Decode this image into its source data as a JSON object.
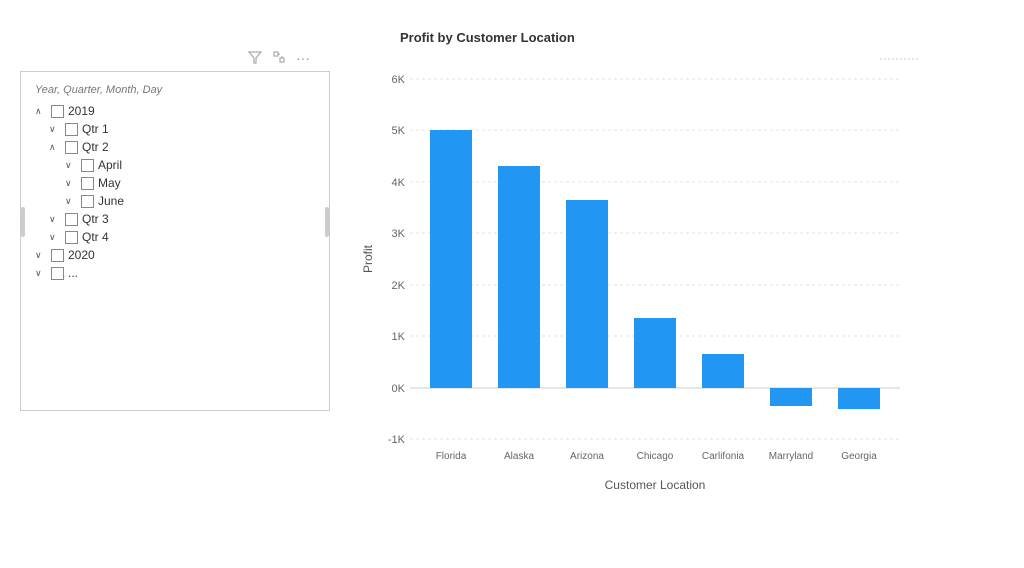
{
  "leftPanel": {
    "icons": [
      "filter-icon",
      "expand-icon",
      "more-icon"
    ],
    "treeHeader": "Year, Quarter, Month, Day",
    "items": [
      {
        "id": "2019",
        "label": "2019",
        "indent": 0,
        "chevron": "up-open",
        "checked": false
      },
      {
        "id": "qtr1",
        "label": "Qtr 1",
        "indent": 1,
        "chevron": "down",
        "checked": false
      },
      {
        "id": "qtr2",
        "label": "Qtr 2",
        "indent": 1,
        "chevron": "up-open",
        "checked": false
      },
      {
        "id": "april",
        "label": "April",
        "indent": 2,
        "chevron": "down",
        "checked": false
      },
      {
        "id": "may",
        "label": "May",
        "indent": 2,
        "chevron": "down",
        "checked": false
      },
      {
        "id": "june",
        "label": "June",
        "indent": 2,
        "chevron": "down",
        "checked": false
      },
      {
        "id": "qtr3",
        "label": "Qtr 3",
        "indent": 1,
        "chevron": "down",
        "checked": false
      },
      {
        "id": "qtr4",
        "label": "Qtr 4",
        "indent": 1,
        "chevron": "down",
        "checked": false
      },
      {
        "id": "2020",
        "label": "2020",
        "indent": 0,
        "chevron": "down",
        "checked": false
      },
      {
        "id": "2021",
        "label": "...",
        "indent": 0,
        "chevron": "down",
        "checked": false
      }
    ]
  },
  "chart": {
    "title": "Profit by Customer Location",
    "yAxisLabel": "Profit",
    "xAxisLabel": "Customer Location",
    "yTicks": [
      "6K",
      "5K",
      "4K",
      "3K",
      "2K",
      "1K",
      "0K",
      "-1K"
    ],
    "bars": [
      {
        "location": "Florida",
        "value": 5000,
        "color": "#2196f3"
      },
      {
        "location": "Alaska",
        "value": 4300,
        "color": "#2196f3"
      },
      {
        "location": "Arizona",
        "value": 3650,
        "color": "#2196f3"
      },
      {
        "location": "Chicago",
        "value": 1350,
        "color": "#2196f3"
      },
      {
        "location": "Carlifonia",
        "value": 650,
        "color": "#2196f3"
      },
      {
        "location": "Marryland",
        "value": -350,
        "color": "#2196f3"
      },
      {
        "location": "Georgia",
        "value": -400,
        "color": "#2196f3"
      }
    ],
    "yMin": -1000,
    "yMax": 6000
  }
}
